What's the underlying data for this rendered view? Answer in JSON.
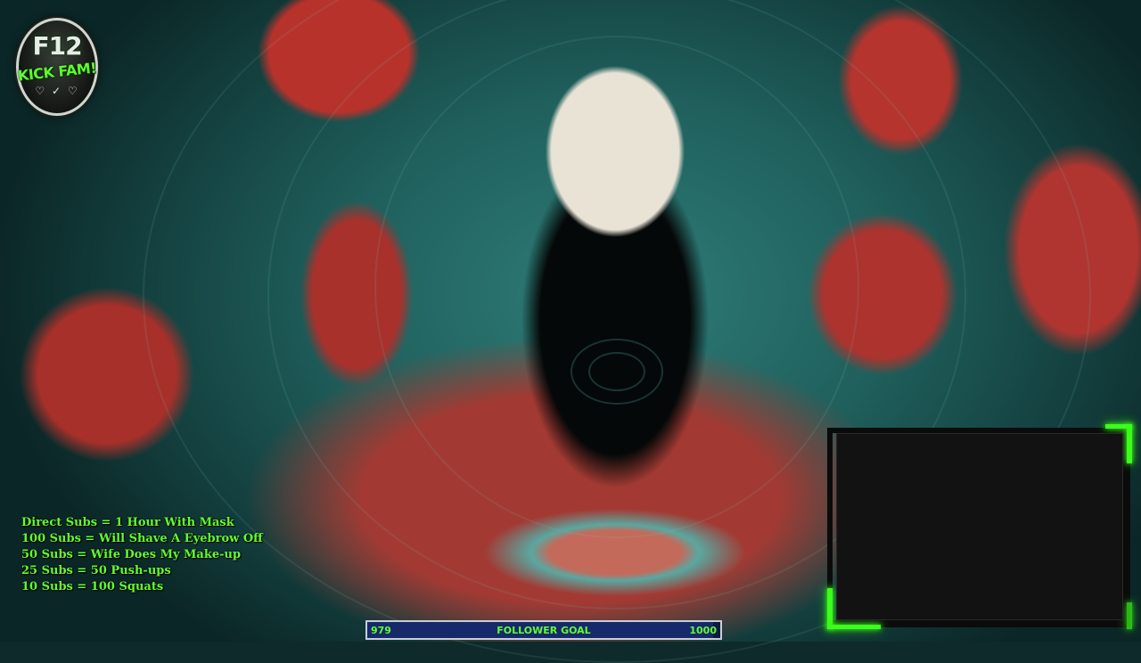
{
  "logo": {
    "top_text": "F12",
    "bottom_text": "KICK FAM!",
    "hearts": "♡ ✓ ♡"
  },
  "sub_goals": [
    "Direct Subs = 1 Hour With Mask",
    "100 Subs = Will Shave A Eyebrow Off",
    "50 Subs = Wife Does My Make-up",
    "25 Subs = 50 Push-ups",
    "10 Subs = 100 Squats"
  ],
  "follower_goal": {
    "label": "FOLLOWER GOAL",
    "current": "979",
    "target": "1000",
    "progress": 0.979
  },
  "colors": {
    "accent_green": "#62ff2e",
    "bar_background": "#0c1a40",
    "bar_border": "#c9ced8"
  }
}
